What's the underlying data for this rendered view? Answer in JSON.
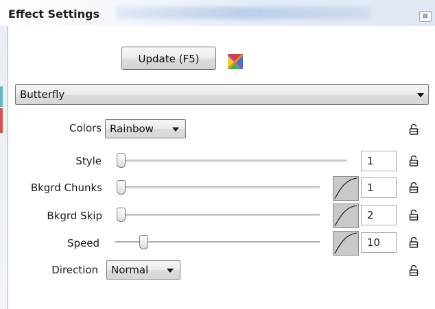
{
  "window": {
    "title": "Effect Settings",
    "close_glyph": "⊠"
  },
  "toolbar": {
    "update_label": "Update (F5)",
    "effect_icon": "color-x-icon"
  },
  "effect_select": {
    "value": "Butterfly"
  },
  "rows": {
    "colors": {
      "label": "Colors",
      "value": "Rainbow"
    },
    "style": {
      "label": "Style",
      "value": "1",
      "level": 0.0
    },
    "bkgrd_chunks": {
      "label": "Bkgrd Chunks",
      "value": "1",
      "level": 0.0
    },
    "bkgrd_skip": {
      "label": "Bkgrd Skip",
      "value": "2",
      "level": 0.0
    },
    "speed": {
      "label": "Speed",
      "value": "10",
      "level": 0.13
    },
    "direction": {
      "label": "Direction",
      "value": "Normal"
    }
  },
  "colors": {
    "accent_left_teal": "#5fb7c9",
    "accent_left_red": "#d8524c"
  }
}
